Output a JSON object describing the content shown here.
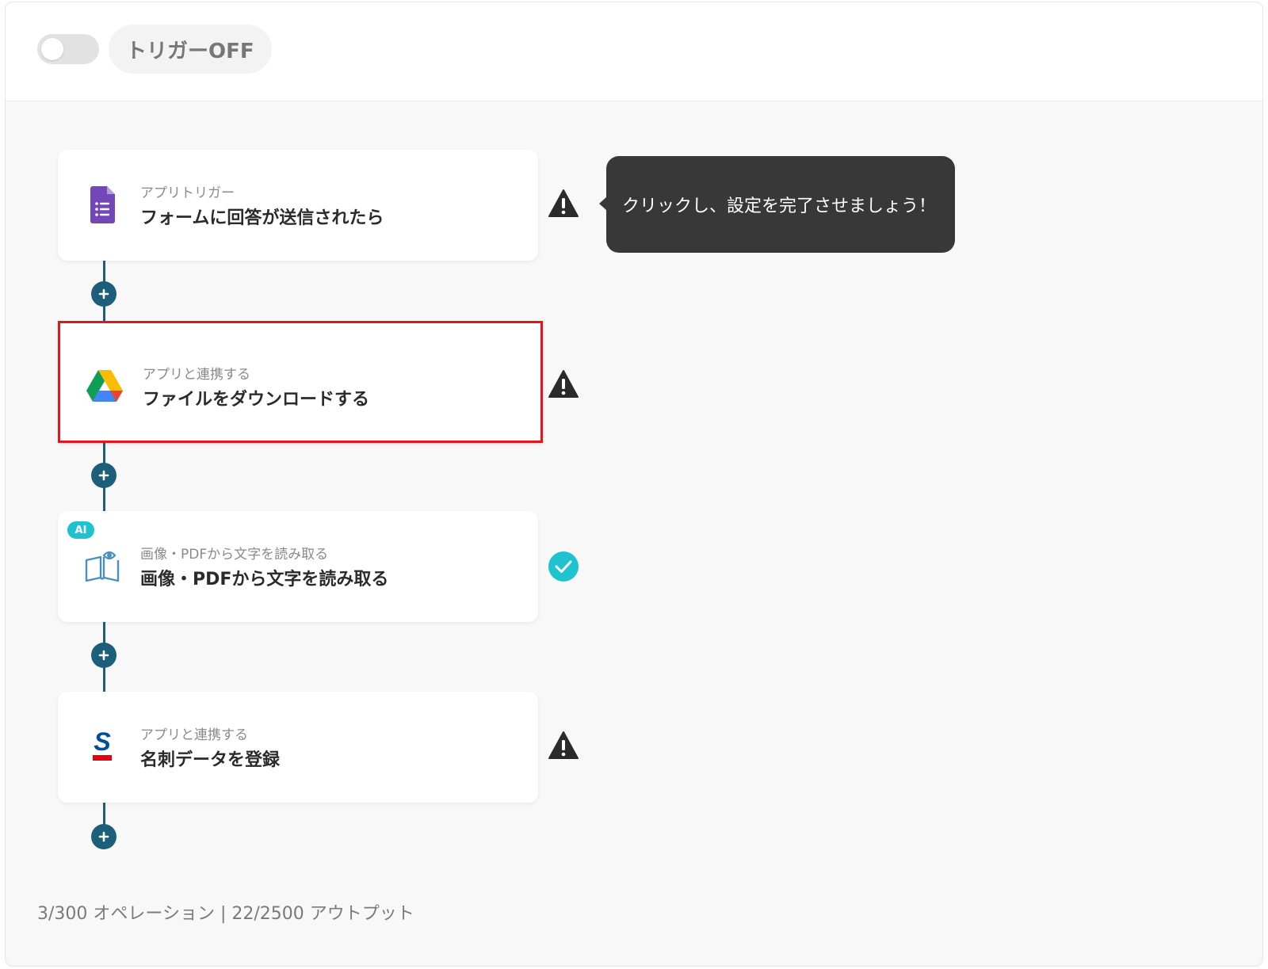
{
  "header": {
    "trigger_label": "トリガーOFF",
    "toggle_state": "off"
  },
  "tooltip": {
    "text": "クリックし、設定を完了させましょう！"
  },
  "steps": [
    {
      "sub": "アプリトリガー",
      "title": "フォームに回答が送信されたら",
      "icon": "google-forms-icon",
      "status": "warning"
    },
    {
      "sub": "アプリと連携する",
      "title": "ファイルをダウンロードする",
      "icon": "google-drive-icon",
      "status": "warning",
      "highlighted": true
    },
    {
      "sub": "画像・PDFから文字を読み取る",
      "title": "画像・PDFから文字を読み取る",
      "icon": "ocr-book-icon",
      "status": "complete",
      "badge": "AI"
    },
    {
      "sub": "アプリと連携する",
      "title": "名刺データを登録",
      "icon": "sansan-icon",
      "status": "warning"
    }
  ],
  "footer": {
    "usage": "3/300 オペレーション | 22/2500 アウトプット"
  },
  "colors": {
    "accent": "#1b5f7a",
    "highlight_border": "#e6141c",
    "complete": "#1fc3cf",
    "warning": "#2b2b2b"
  }
}
